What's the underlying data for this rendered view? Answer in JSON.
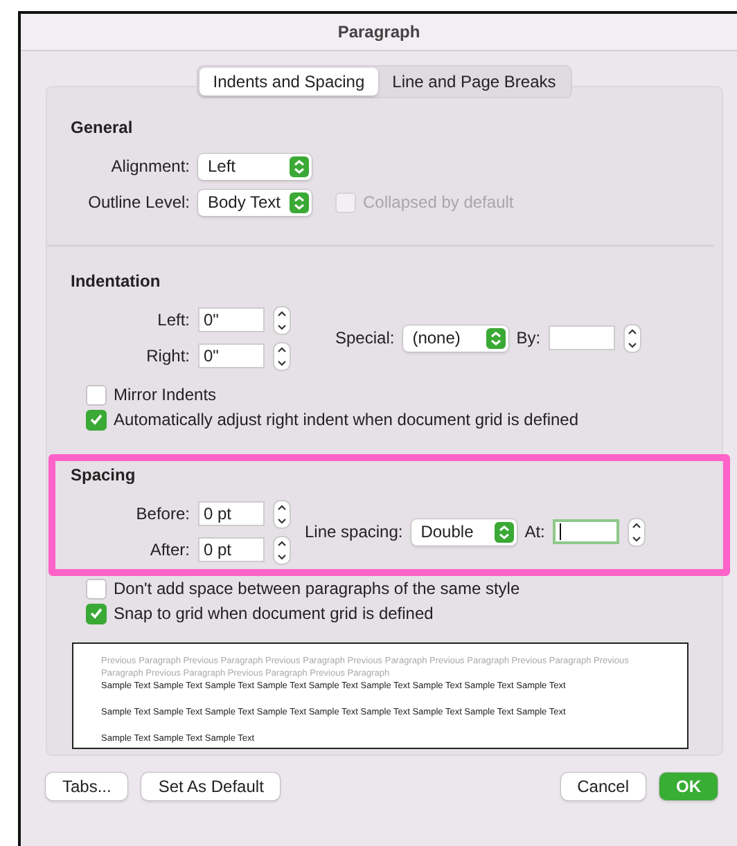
{
  "window": {
    "title": "Paragraph"
  },
  "tabs": [
    {
      "label": "Indents and Spacing",
      "selected": true
    },
    {
      "label": "Line and Page Breaks",
      "selected": false
    }
  ],
  "general": {
    "heading": "General",
    "alignment": {
      "label": "Alignment:",
      "value": "Left"
    },
    "outline_level": {
      "label": "Outline Level:",
      "value": "Body Text"
    },
    "collapsed": {
      "label": "Collapsed by default",
      "checked": false,
      "disabled": true
    }
  },
  "indentation": {
    "heading": "Indentation",
    "left": {
      "label": "Left:",
      "value": "0\""
    },
    "right": {
      "label": "Right:",
      "value": "0\""
    },
    "special": {
      "label": "Special:",
      "value": "(none)"
    },
    "by": {
      "label": "By:"
    },
    "checkboxes": [
      {
        "label": "Mirror Indents",
        "checked": false
      },
      {
        "label": "Automatically adjust right indent when document grid is defined",
        "checked": true
      }
    ]
  },
  "spacing": {
    "heading": "Spacing",
    "highlighted": true,
    "before": {
      "label": "Before:",
      "value": "0 pt"
    },
    "after": {
      "label": "After:",
      "value": "0 pt"
    },
    "line_spacing": {
      "label": "Line spacing:",
      "value": "Double"
    },
    "at": {
      "label": "At:",
      "focused": true
    },
    "checkboxes": [
      {
        "label": "Don't add space between paragraphs of the same style",
        "checked": false
      },
      {
        "label": "Snap to grid when document grid is defined",
        "checked": true
      }
    ]
  },
  "preview": {
    "previous": "Previous Paragraph Previous Paragraph Previous Paragraph Previous Paragraph Previous Paragraph Previous Paragraph Previous Paragraph Previous Paragraph Previous Paragraph Previous Paragraph",
    "sample_lines": [
      "Sample Text Sample Text Sample Text Sample Text Sample Text Sample Text Sample Text Sample Text Sample Text",
      "Sample Text Sample Text Sample Text Sample Text Sample Text Sample Text Sample Text Sample Text Sample Text",
      "Sample Text Sample Text Sample Text"
    ]
  },
  "buttons": [
    {
      "label": "Tabs...",
      "kind": "plain"
    },
    {
      "label": "Set As Default",
      "kind": "plain"
    },
    {
      "label": "Cancel",
      "kind": "plain"
    },
    {
      "label": "OK",
      "kind": "primary"
    }
  ]
}
